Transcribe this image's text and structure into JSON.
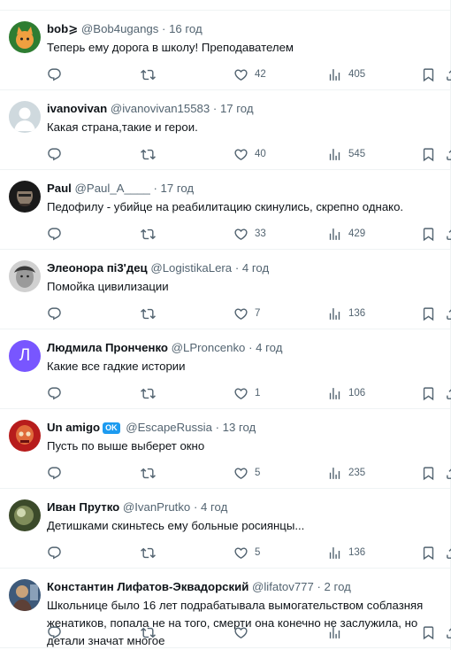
{
  "tweets": [
    {
      "name": "bob⩾",
      "handle": "@Bob4ugangs",
      "time": "· 16 год",
      "text": "Теперь ему дорога в школу! Преподавателем",
      "replies": "",
      "retweets": "",
      "likes": "42",
      "views": "405",
      "avatar": {
        "kind": "cat",
        "colors": [
          "#2e7d32",
          "#f0a040"
        ]
      }
    },
    {
      "name": "ivanovivan",
      "handle": "@ivanovivan15583",
      "time": "· 17 год",
      "text": "Какая страна,такие и герои.",
      "replies": "",
      "retweets": "",
      "likes": "40",
      "views": "545",
      "avatar": {
        "kind": "default",
        "colors": [
          "#cfd9de",
          "#ffffff"
        ]
      }
    },
    {
      "name": "Paul",
      "handle": "@Paul_A____",
      "time": "· 17 год",
      "text": "Педофилу - убийце на реабилитацию скинулись, скрепно однако.",
      "replies": "",
      "retweets": "",
      "likes": "33",
      "views": "429",
      "avatar": {
        "kind": "dark-face",
        "colors": [
          "#1a1a1a",
          "#8a7a6a"
        ]
      }
    },
    {
      "name": "Элеонора пі3'дец",
      "handle": "@LogistikaLera",
      "time": "· 4 год",
      "text": "Помойка цивилизации",
      "replies": "",
      "retweets": "",
      "likes": "7",
      "views": "136",
      "avatar": {
        "kind": "bw-face",
        "colors": [
          "#d0d0d0",
          "#3a3a3a"
        ]
      }
    },
    {
      "name": "Людмила Пронченко",
      "handle": "@LProncenko",
      "time": "· 4 год",
      "text": "Какие все гадкие истории",
      "replies": "",
      "retweets": "",
      "likes": "1",
      "views": "106",
      "avatar": {
        "kind": "letter",
        "letter": "Л",
        "colors": [
          "#7856ff",
          "#ffffff"
        ]
      }
    },
    {
      "name": "Un amigo",
      "badge": "OK",
      "handle": "@EscapeRussia",
      "time": "· 13 год",
      "text": "Пусть по выше выберет окно",
      "replies": "",
      "retweets": "",
      "likes": "5",
      "views": "235",
      "avatar": {
        "kind": "skull",
        "colors": [
          "#b71c1c",
          "#f5e0c0"
        ]
      }
    },
    {
      "name": "Иван Прутко",
      "handle": "@IvanPrutko",
      "time": "· 4 год",
      "text": "Детишками скиньтесь ему больные росиянцы...",
      "replies": "",
      "retweets": "",
      "likes": "5",
      "views": "136",
      "avatar": {
        "kind": "orb",
        "colors": [
          "#3b4a2a",
          "#cfd8b0"
        ]
      }
    },
    {
      "name": "Константин Лифатов-Эквадорский",
      "handle": "@lifatov777",
      "time": "· 2 год",
      "text": "Школьнице было 16 лет подрабатывала вымогательством соблазняя женатиков, попала не на того, смерти она конечно не заслужила, но детали значат многое",
      "replies": "",
      "retweets": "",
      "likes": "",
      "views": "",
      "avatar": {
        "kind": "photo",
        "colors": [
          "#5d4037",
          "#c8a27a"
        ]
      }
    }
  ]
}
